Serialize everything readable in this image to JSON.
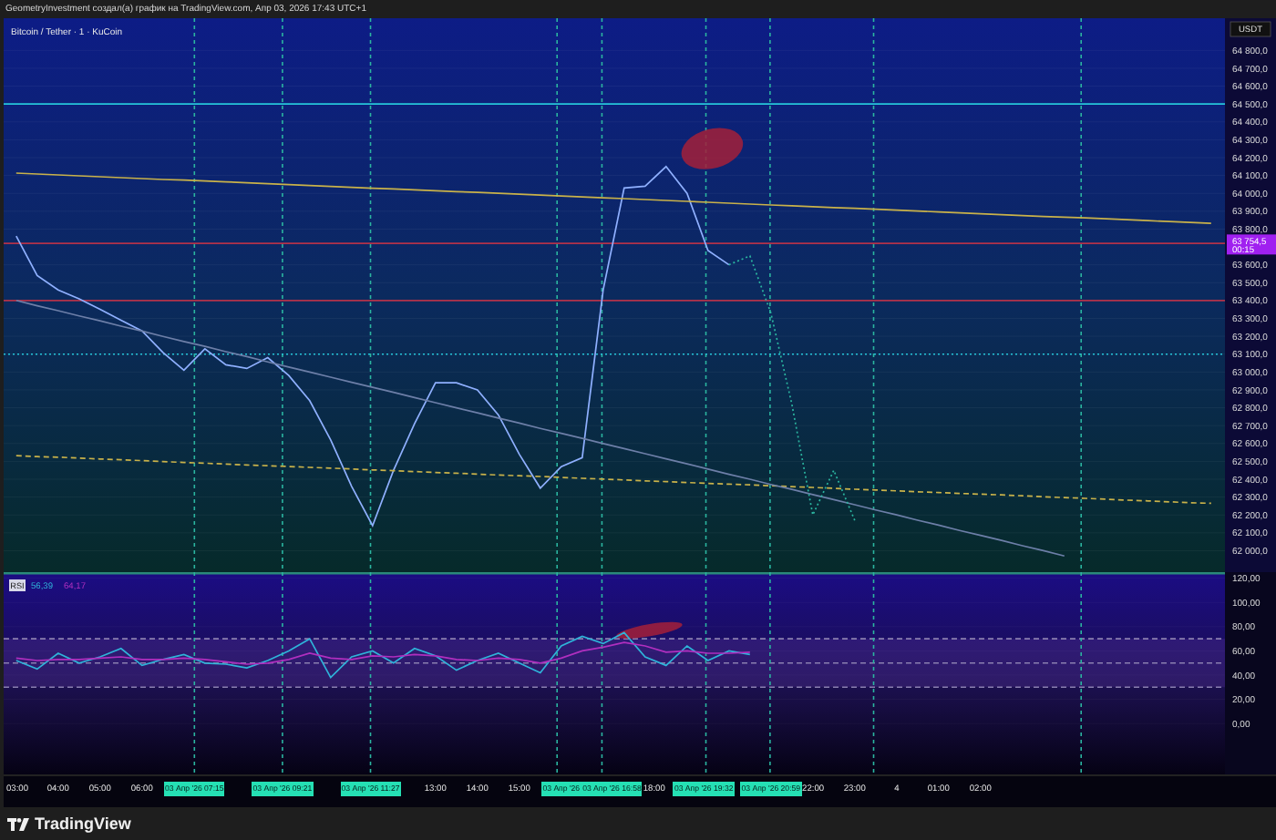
{
  "header": {
    "title": "GeometryInvestment создал(а) график на TradingView.com, Апр 03, 2026 17:43 UTC+1"
  },
  "price_pane": {
    "currency": "USDT",
    "current_price": {
      "label": "63 754,5",
      "countdown": "00:15"
    },
    "chart_data": {
      "type": "line",
      "title": "Bitcoin / Tether · 1 · KuCoin",
      "ylim": [
        61880,
        64980
      ],
      "grid": true,
      "categories": [
        null,
        null,
        null,
        null,
        null,
        null,
        null,
        null,
        null,
        null,
        null,
        null,
        null,
        null,
        null,
        null,
        null,
        null,
        null,
        null,
        null,
        null,
        null,
        null,
        null,
        null,
        null,
        null,
        null,
        null,
        null,
        null,
        null,
        null,
        null,
        null,
        null,
        null,
        null,
        null,
        null,
        null,
        null,
        null,
        null,
        null,
        null,
        null,
        null,
        null,
        null,
        null,
        null,
        null,
        null,
        null,
        null,
        null
      ],
      "series": [
        {
          "color": "#8fb0ff",
          "values": [
            63760,
            63540,
            63460,
            63410,
            63350,
            63290,
            63230,
            63110,
            63010,
            63130,
            63040,
            63020,
            63080,
            62980,
            62840,
            62620,
            62360,
            62140,
            62450,
            62710,
            62940,
            62940,
            62900,
            62760,
            62540,
            62350,
            62470,
            62520,
            63460,
            64030,
            64040,
            64150,
            64000,
            63680,
            63600,
            null,
            null,
            null,
            null,
            null,
            null,
            null,
            null,
            null,
            null,
            null,
            null,
            null,
            null,
            null,
            null,
            null,
            null,
            null,
            null,
            null,
            null,
            null
          ]
        },
        {
          "color": "#c9b24a",
          "values": [
            64113,
            64108,
            64103,
            64098,
            64093,
            64088,
            64083,
            64078,
            64074,
            64069,
            64064,
            64059,
            64054,
            64049,
            64044,
            64039,
            64034,
            64029,
            64024,
            64019,
            64014,
            64009,
            64005,
            64000,
            63995,
            63990,
            63985,
            63980,
            63975,
            63970,
            63965,
            63960,
            63955,
            63950,
            63945,
            63940,
            63935,
            63931,
            63926,
            63921,
            63916,
            63911,
            63906,
            63901,
            63896,
            63891,
            63886,
            63881,
            63876,
            63871,
            63866,
            63862,
            63857,
            63852,
            63847,
            63842,
            63837,
            63832
          ]
        },
        {
          "color": "#c9b24a",
          "line_style": "dashed",
          "values": [
            62532,
            62527,
            62523,
            62518,
            62513,
            62509,
            62504,
            62499,
            62494,
            62490,
            62485,
            62480,
            62476,
            62471,
            62466,
            62462,
            62457,
            62452,
            62448,
            62443,
            62438,
            62434,
            62429,
            62424,
            62419,
            62415,
            62410,
            62405,
            62401,
            62396,
            62391,
            62387,
            62382,
            62377,
            62373,
            62368,
            62363,
            62358,
            62354,
            62349,
            62344,
            62340,
            62335,
            62330,
            62326,
            62321,
            62316,
            62312,
            62307,
            62302,
            62297,
            62293,
            62288,
            62283,
            62279,
            62274,
            62269,
            62265
          ]
        },
        {
          "color": "#6d7fa8",
          "values": [
            63400,
            63371,
            63343,
            63314,
            63286,
            63257,
            63229,
            63200,
            63171,
            63143,
            63114,
            63086,
            63057,
            63028,
            63000,
            62971,
            62943,
            62914,
            62886,
            62857,
            62828,
            62800,
            62771,
            62743,
            62714,
            62685,
            62657,
            62628,
            62600,
            62571,
            62543,
            62514,
            62486,
            62457,
            62428,
            62400,
            62371,
            62343,
            62314,
            62286,
            62257,
            62228,
            62200,
            62171,
            62143,
            62114,
            62086,
            62057,
            62028,
            62000,
            61971,
            null,
            null,
            null,
            null,
            null,
            null,
            null
          ]
        },
        {
          "color": "#2bb5a0",
          "line_style": "dotted",
          "values": [
            null,
            null,
            null,
            null,
            null,
            null,
            null,
            null,
            null,
            null,
            null,
            null,
            null,
            null,
            null,
            null,
            null,
            null,
            null,
            null,
            null,
            null,
            null,
            null,
            null,
            null,
            null,
            null,
            null,
            null,
            null,
            null,
            null,
            null,
            63600,
            63650,
            63330,
            62820,
            62200,
            62450,
            62170,
            null,
            null,
            null,
            null,
            null,
            null,
            null,
            null,
            null,
            null,
            null,
            null,
            null,
            null,
            null,
            null,
            null
          ]
        }
      ],
      "ref_lines": [
        {
          "axis": "y",
          "value": 64500,
          "color": "#26c6da"
        },
        {
          "axis": "y",
          "value": 63720,
          "color": "#b2324a"
        },
        {
          "axis": "y",
          "value": 63400,
          "color": "#b2324a"
        },
        {
          "axis": "y",
          "value": 63100,
          "color": "#26c6da"
        }
      ],
      "yticks": [
        {
          "value": 64800,
          "label": "64 800,0"
        },
        {
          "value": 64700,
          "label": "64 700,0"
        },
        {
          "value": 64600,
          "label": "64 600,0"
        },
        {
          "value": 64500,
          "label": "64 500,0"
        },
        {
          "value": 64400,
          "label": "64 400,0"
        },
        {
          "value": 64300,
          "label": "64 300,0"
        },
        {
          "value": 64200,
          "label": "64 200,0"
        },
        {
          "value": 64100,
          "label": "64 100,0"
        },
        {
          "value": 64000,
          "label": "64 000,0"
        },
        {
          "value": 63900,
          "label": "63 900,0"
        },
        {
          "value": 63800,
          "label": "63 800,0"
        },
        {
          "value": 63600,
          "label": "63 600,0"
        },
        {
          "value": 63500,
          "label": "63 500,0"
        },
        {
          "value": 63400,
          "label": "63 400,0"
        },
        {
          "value": 63300,
          "label": "63 300,0"
        },
        {
          "value": 63200,
          "label": "63 200,0"
        },
        {
          "value": 63100,
          "label": "63 100,0"
        },
        {
          "value": 63000,
          "label": "63 000,0"
        },
        {
          "value": 62900,
          "label": "62 900,0"
        },
        {
          "value": 62800,
          "label": "62 800,0"
        },
        {
          "value": 62700,
          "label": "62 700,0"
        },
        {
          "value": 62600,
          "label": "62 600,0"
        },
        {
          "value": 62500,
          "label": "62 500,0"
        },
        {
          "value": 62400,
          "label": "62 400,0"
        },
        {
          "value": 62300,
          "label": "62 300,0"
        },
        {
          "value": 62200,
          "label": "62 200,0"
        },
        {
          "value": 62100,
          "label": "62 100,0"
        },
        {
          "value": 62000,
          "label": "62 000,0"
        }
      ]
    }
  },
  "rsi_pane": {
    "legend_values": [
      "56,39",
      "64,17"
    ],
    "chart_data": {
      "type": "line",
      "title": "RSI",
      "ylim": [
        -42,
        125
      ],
      "grid": true,
      "bands": [
        {
          "axis": "y",
          "from": 30,
          "to": 70,
          "color": "#6a3fb0"
        }
      ],
      "ref_lines": [
        {
          "axis": "y",
          "value": 70,
          "color": "#8a7fb0"
        },
        {
          "axis": "y",
          "value": 50,
          "color": "#8a7fb0"
        },
        {
          "axis": "y",
          "value": 30,
          "color": "#8a7fb0"
        }
      ],
      "categories": [
        null,
        null,
        null,
        null,
        null,
        null,
        null,
        null,
        null,
        null,
        null,
        null,
        null,
        null,
        null,
        null,
        null,
        null,
        null,
        null,
        null,
        null,
        null,
        null,
        null,
        null,
        null,
        null,
        null,
        null,
        null,
        null,
        null,
        null,
        null,
        null
      ],
      "series": [
        {
          "color": "#2fb3d9",
          "values": [
            52,
            45,
            58,
            50,
            55,
            62,
            48,
            53,
            57,
            50,
            49,
            46,
            52,
            60,
            70,
            38,
            55,
            60,
            50,
            62,
            56,
            44,
            52,
            58,
            50,
            42,
            64,
            72,
            66,
            75,
            55,
            48,
            64,
            52,
            60,
            57
          ]
        },
        {
          "color": "#b02fbf",
          "values": [
            54,
            52,
            53,
            53,
            54,
            55,
            53,
            53,
            54,
            53,
            51,
            49,
            50,
            53,
            58,
            54,
            53,
            56,
            55,
            57,
            56,
            53,
            52,
            54,
            53,
            50,
            54,
            60,
            63,
            67,
            64,
            59,
            60,
            58,
            58,
            59
          ]
        }
      ],
      "yticks": [
        {
          "value": 120,
          "label": "120,00"
        },
        {
          "value": 100,
          "label": "100,00"
        },
        {
          "value": 80,
          "label": "80,00"
        },
        {
          "value": 60,
          "label": "60,00"
        },
        {
          "value": 40,
          "label": "40,00"
        },
        {
          "value": 20,
          "label": "20,00"
        },
        {
          "value": 0,
          "label": "0,00"
        }
      ]
    }
  },
  "time_axis": {
    "ticks": [
      "03:00",
      "04:00",
      "05:00",
      "06:00",
      "13:00",
      "14:00",
      "15:00",
      "18:00",
      "22:00",
      "23:00",
      "4",
      "01:00",
      "02:00"
    ],
    "badges": [
      "03 Апр '26 07:15",
      "03 Апр '26 09:21",
      "03 Апр '26 11:27",
      "03 Апр '26",
      "03 Апр '26 16:58",
      "03 Апр '26 19:32",
      "03 Апр '26 20:59"
    ]
  },
  "footer": {
    "brand": "TradingView"
  }
}
